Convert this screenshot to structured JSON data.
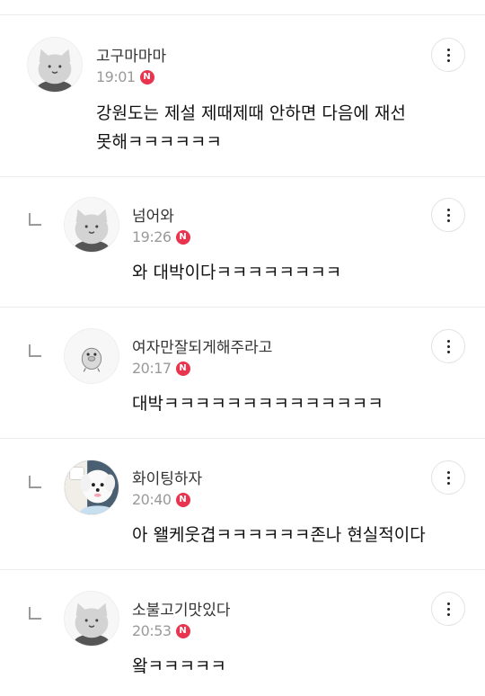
{
  "new_badge": "N",
  "comments": [
    {
      "nickname": "고구마마마",
      "time": "19:01",
      "line1": "강원도는 제설 제때제때 안하면 다음에 재선",
      "line2": "못해ㅋㅋㅋㅋㅋㅋ",
      "avatar_icon": "cat-face-icon",
      "is_reply": false
    },
    {
      "nickname": "넘어와",
      "time": "19:26",
      "line1": "와 대박이다ㅋㅋㅋㅋㅋㅋㅋㅋ",
      "avatar_icon": "cat-face-icon",
      "is_reply": true
    },
    {
      "nickname": "여자만잘되게해주라고",
      "time": "20:17",
      "line1": "대박ㅋㅋㅋㅋㅋㅋㅋㅋㅋㅋㅋㅋㅋㅋ",
      "avatar_icon": "duck-icon",
      "is_reply": true
    },
    {
      "nickname": "화이팅하자",
      "time": "20:40",
      "line1": "아 왤케웃겹ㅋㅋㅋㅋㅋㅋ존나 현실적이다",
      "avatar_icon": "puppy-photo-icon",
      "is_reply": true
    },
    {
      "nickname": "소불고기맛있다",
      "time": "20:53",
      "line1": "왘ㅋㅋㅋㅋㅋ",
      "avatar_icon": "cat-face-icon",
      "is_reply": true
    }
  ],
  "colors": {
    "new_badge": "#e8344e",
    "time": "#9a9a9a",
    "divider": "#ececec"
  }
}
